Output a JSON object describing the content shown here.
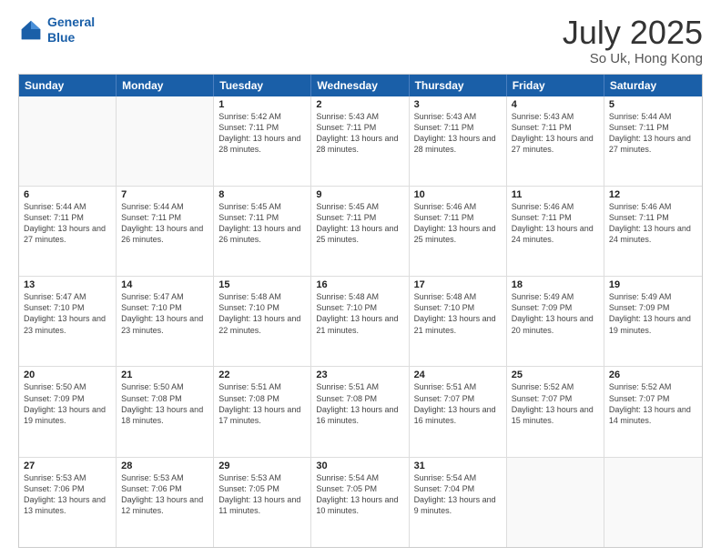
{
  "header": {
    "logo_line1": "General",
    "logo_line2": "Blue",
    "title": "July 2025",
    "subtitle": "So Uk, Hong Kong"
  },
  "weekdays": [
    "Sunday",
    "Monday",
    "Tuesday",
    "Wednesday",
    "Thursday",
    "Friday",
    "Saturday"
  ],
  "weeks": [
    [
      {
        "day": "",
        "sunrise": "",
        "sunset": "",
        "daylight": ""
      },
      {
        "day": "",
        "sunrise": "",
        "sunset": "",
        "daylight": ""
      },
      {
        "day": "1",
        "sunrise": "Sunrise: 5:42 AM",
        "sunset": "Sunset: 7:11 PM",
        "daylight": "Daylight: 13 hours and 28 minutes."
      },
      {
        "day": "2",
        "sunrise": "Sunrise: 5:43 AM",
        "sunset": "Sunset: 7:11 PM",
        "daylight": "Daylight: 13 hours and 28 minutes."
      },
      {
        "day": "3",
        "sunrise": "Sunrise: 5:43 AM",
        "sunset": "Sunset: 7:11 PM",
        "daylight": "Daylight: 13 hours and 28 minutes."
      },
      {
        "day": "4",
        "sunrise": "Sunrise: 5:43 AM",
        "sunset": "Sunset: 7:11 PM",
        "daylight": "Daylight: 13 hours and 27 minutes."
      },
      {
        "day": "5",
        "sunrise": "Sunrise: 5:44 AM",
        "sunset": "Sunset: 7:11 PM",
        "daylight": "Daylight: 13 hours and 27 minutes."
      }
    ],
    [
      {
        "day": "6",
        "sunrise": "Sunrise: 5:44 AM",
        "sunset": "Sunset: 7:11 PM",
        "daylight": "Daylight: 13 hours and 27 minutes."
      },
      {
        "day": "7",
        "sunrise": "Sunrise: 5:44 AM",
        "sunset": "Sunset: 7:11 PM",
        "daylight": "Daylight: 13 hours and 26 minutes."
      },
      {
        "day": "8",
        "sunrise": "Sunrise: 5:45 AM",
        "sunset": "Sunset: 7:11 PM",
        "daylight": "Daylight: 13 hours and 26 minutes."
      },
      {
        "day": "9",
        "sunrise": "Sunrise: 5:45 AM",
        "sunset": "Sunset: 7:11 PM",
        "daylight": "Daylight: 13 hours and 25 minutes."
      },
      {
        "day": "10",
        "sunrise": "Sunrise: 5:46 AM",
        "sunset": "Sunset: 7:11 PM",
        "daylight": "Daylight: 13 hours and 25 minutes."
      },
      {
        "day": "11",
        "sunrise": "Sunrise: 5:46 AM",
        "sunset": "Sunset: 7:11 PM",
        "daylight": "Daylight: 13 hours and 24 minutes."
      },
      {
        "day": "12",
        "sunrise": "Sunrise: 5:46 AM",
        "sunset": "Sunset: 7:11 PM",
        "daylight": "Daylight: 13 hours and 24 minutes."
      }
    ],
    [
      {
        "day": "13",
        "sunrise": "Sunrise: 5:47 AM",
        "sunset": "Sunset: 7:10 PM",
        "daylight": "Daylight: 13 hours and 23 minutes."
      },
      {
        "day": "14",
        "sunrise": "Sunrise: 5:47 AM",
        "sunset": "Sunset: 7:10 PM",
        "daylight": "Daylight: 13 hours and 23 minutes."
      },
      {
        "day": "15",
        "sunrise": "Sunrise: 5:48 AM",
        "sunset": "Sunset: 7:10 PM",
        "daylight": "Daylight: 13 hours and 22 minutes."
      },
      {
        "day": "16",
        "sunrise": "Sunrise: 5:48 AM",
        "sunset": "Sunset: 7:10 PM",
        "daylight": "Daylight: 13 hours and 21 minutes."
      },
      {
        "day": "17",
        "sunrise": "Sunrise: 5:48 AM",
        "sunset": "Sunset: 7:10 PM",
        "daylight": "Daylight: 13 hours and 21 minutes."
      },
      {
        "day": "18",
        "sunrise": "Sunrise: 5:49 AM",
        "sunset": "Sunset: 7:09 PM",
        "daylight": "Daylight: 13 hours and 20 minutes."
      },
      {
        "day": "19",
        "sunrise": "Sunrise: 5:49 AM",
        "sunset": "Sunset: 7:09 PM",
        "daylight": "Daylight: 13 hours and 19 minutes."
      }
    ],
    [
      {
        "day": "20",
        "sunrise": "Sunrise: 5:50 AM",
        "sunset": "Sunset: 7:09 PM",
        "daylight": "Daylight: 13 hours and 19 minutes."
      },
      {
        "day": "21",
        "sunrise": "Sunrise: 5:50 AM",
        "sunset": "Sunset: 7:08 PM",
        "daylight": "Daylight: 13 hours and 18 minutes."
      },
      {
        "day": "22",
        "sunrise": "Sunrise: 5:51 AM",
        "sunset": "Sunset: 7:08 PM",
        "daylight": "Daylight: 13 hours and 17 minutes."
      },
      {
        "day": "23",
        "sunrise": "Sunrise: 5:51 AM",
        "sunset": "Sunset: 7:08 PM",
        "daylight": "Daylight: 13 hours and 16 minutes."
      },
      {
        "day": "24",
        "sunrise": "Sunrise: 5:51 AM",
        "sunset": "Sunset: 7:07 PM",
        "daylight": "Daylight: 13 hours and 16 minutes."
      },
      {
        "day": "25",
        "sunrise": "Sunrise: 5:52 AM",
        "sunset": "Sunset: 7:07 PM",
        "daylight": "Daylight: 13 hours and 15 minutes."
      },
      {
        "day": "26",
        "sunrise": "Sunrise: 5:52 AM",
        "sunset": "Sunset: 7:07 PM",
        "daylight": "Daylight: 13 hours and 14 minutes."
      }
    ],
    [
      {
        "day": "27",
        "sunrise": "Sunrise: 5:53 AM",
        "sunset": "Sunset: 7:06 PM",
        "daylight": "Daylight: 13 hours and 13 minutes."
      },
      {
        "day": "28",
        "sunrise": "Sunrise: 5:53 AM",
        "sunset": "Sunset: 7:06 PM",
        "daylight": "Daylight: 13 hours and 12 minutes."
      },
      {
        "day": "29",
        "sunrise": "Sunrise: 5:53 AM",
        "sunset": "Sunset: 7:05 PM",
        "daylight": "Daylight: 13 hours and 11 minutes."
      },
      {
        "day": "30",
        "sunrise": "Sunrise: 5:54 AM",
        "sunset": "Sunset: 7:05 PM",
        "daylight": "Daylight: 13 hours and 10 minutes."
      },
      {
        "day": "31",
        "sunrise": "Sunrise: 5:54 AM",
        "sunset": "Sunset: 7:04 PM",
        "daylight": "Daylight: 13 hours and 9 minutes."
      },
      {
        "day": "",
        "sunrise": "",
        "sunset": "",
        "daylight": ""
      },
      {
        "day": "",
        "sunrise": "",
        "sunset": "",
        "daylight": ""
      }
    ]
  ]
}
